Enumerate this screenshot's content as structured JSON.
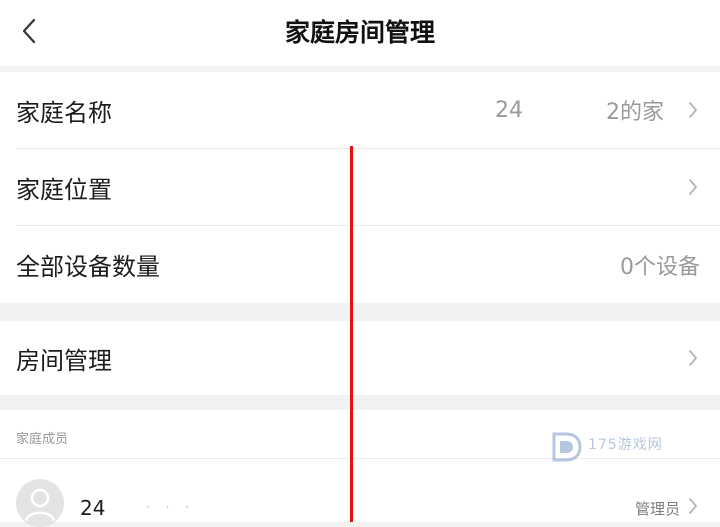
{
  "header": {
    "title": "家庭房间管理",
    "back_icon": "chevron-left-icon"
  },
  "family_settings": {
    "name_row": {
      "label": "家庭名称",
      "value_part1": "24",
      "value_part2": "2的家"
    },
    "location_row": {
      "label": "家庭位置"
    },
    "devices_row": {
      "label": "全部设备数量",
      "value": "0个设备"
    }
  },
  "rooms": {
    "label": "房间管理"
  },
  "members": {
    "section_label": "家庭成员",
    "items": [
      {
        "name": "24",
        "role": "管理员"
      }
    ]
  },
  "watermark": {
    "text": "175游戏网"
  },
  "colors": {
    "background": "#f2f2f2",
    "card": "#ffffff",
    "annotation_line": "#e01414",
    "secondary_text": "#9a9a9a"
  }
}
